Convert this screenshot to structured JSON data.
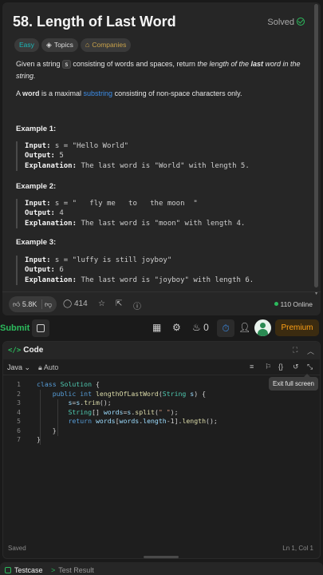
{
  "problem": {
    "title": "58. Length of Last Word",
    "status": "Solved",
    "tags": {
      "difficulty": "Easy",
      "topics": "Topics",
      "companies": "Companies"
    },
    "desc1_a": "Given a string ",
    "desc1_code": "s",
    "desc1_b": " consisting of words and spaces, return ",
    "desc1_em1": "the length of the ",
    "desc1_em_bold": "last",
    "desc1_em2": " word in the string.",
    "desc2_a": "A ",
    "desc2_bold": "word",
    "desc2_b": " is a maximal ",
    "desc2_link": "substring",
    "desc2_c": " consisting of non-space characters only.",
    "examples": [
      {
        "heading": "Example 1:",
        "input_label": "Input:",
        "input": " s = \"Hello World\"",
        "output_label": "Output:",
        "output": " 5",
        "explanation_label": "Explanation:",
        "explanation": " The last word is \"World\" with length 5."
      },
      {
        "heading": "Example 2:",
        "input_label": "Input:",
        "input": " s = \"   fly me   to   the moon  \"",
        "output_label": "Output:",
        "output": " 4",
        "explanation_label": "Explanation:",
        "explanation": " The last word is \"moon\" with length 4."
      },
      {
        "heading": "Example 3:",
        "input_label": "Input:",
        "input": " s = \"luffy is still joyboy\"",
        "output_label": "Output:",
        "output": " 6",
        "explanation_label": "Explanation:",
        "explanation": " The last word is \"joyboy\" with length 6."
      }
    ]
  },
  "actions": {
    "likes": "5.8K",
    "comments": "414",
    "online": "110 Online"
  },
  "topbar": {
    "submit": "Submit",
    "streak": "0",
    "premium": "Premium"
  },
  "editor": {
    "title": "Code",
    "language": "Java",
    "auto": "Auto",
    "tooltip": "Exit full screen",
    "line_numbers": [
      "1",
      "2",
      "3",
      "4",
      "5",
      "6",
      "7"
    ],
    "status_saved": "Saved",
    "status_pos": "Ln 1, Col 1"
  },
  "bottom": {
    "testcase": "Testcase",
    "result": "Test Result"
  },
  "colors": {
    "accent_green": "#2cbb5d",
    "premium": "#ffa116",
    "link": "#3c8de8"
  }
}
